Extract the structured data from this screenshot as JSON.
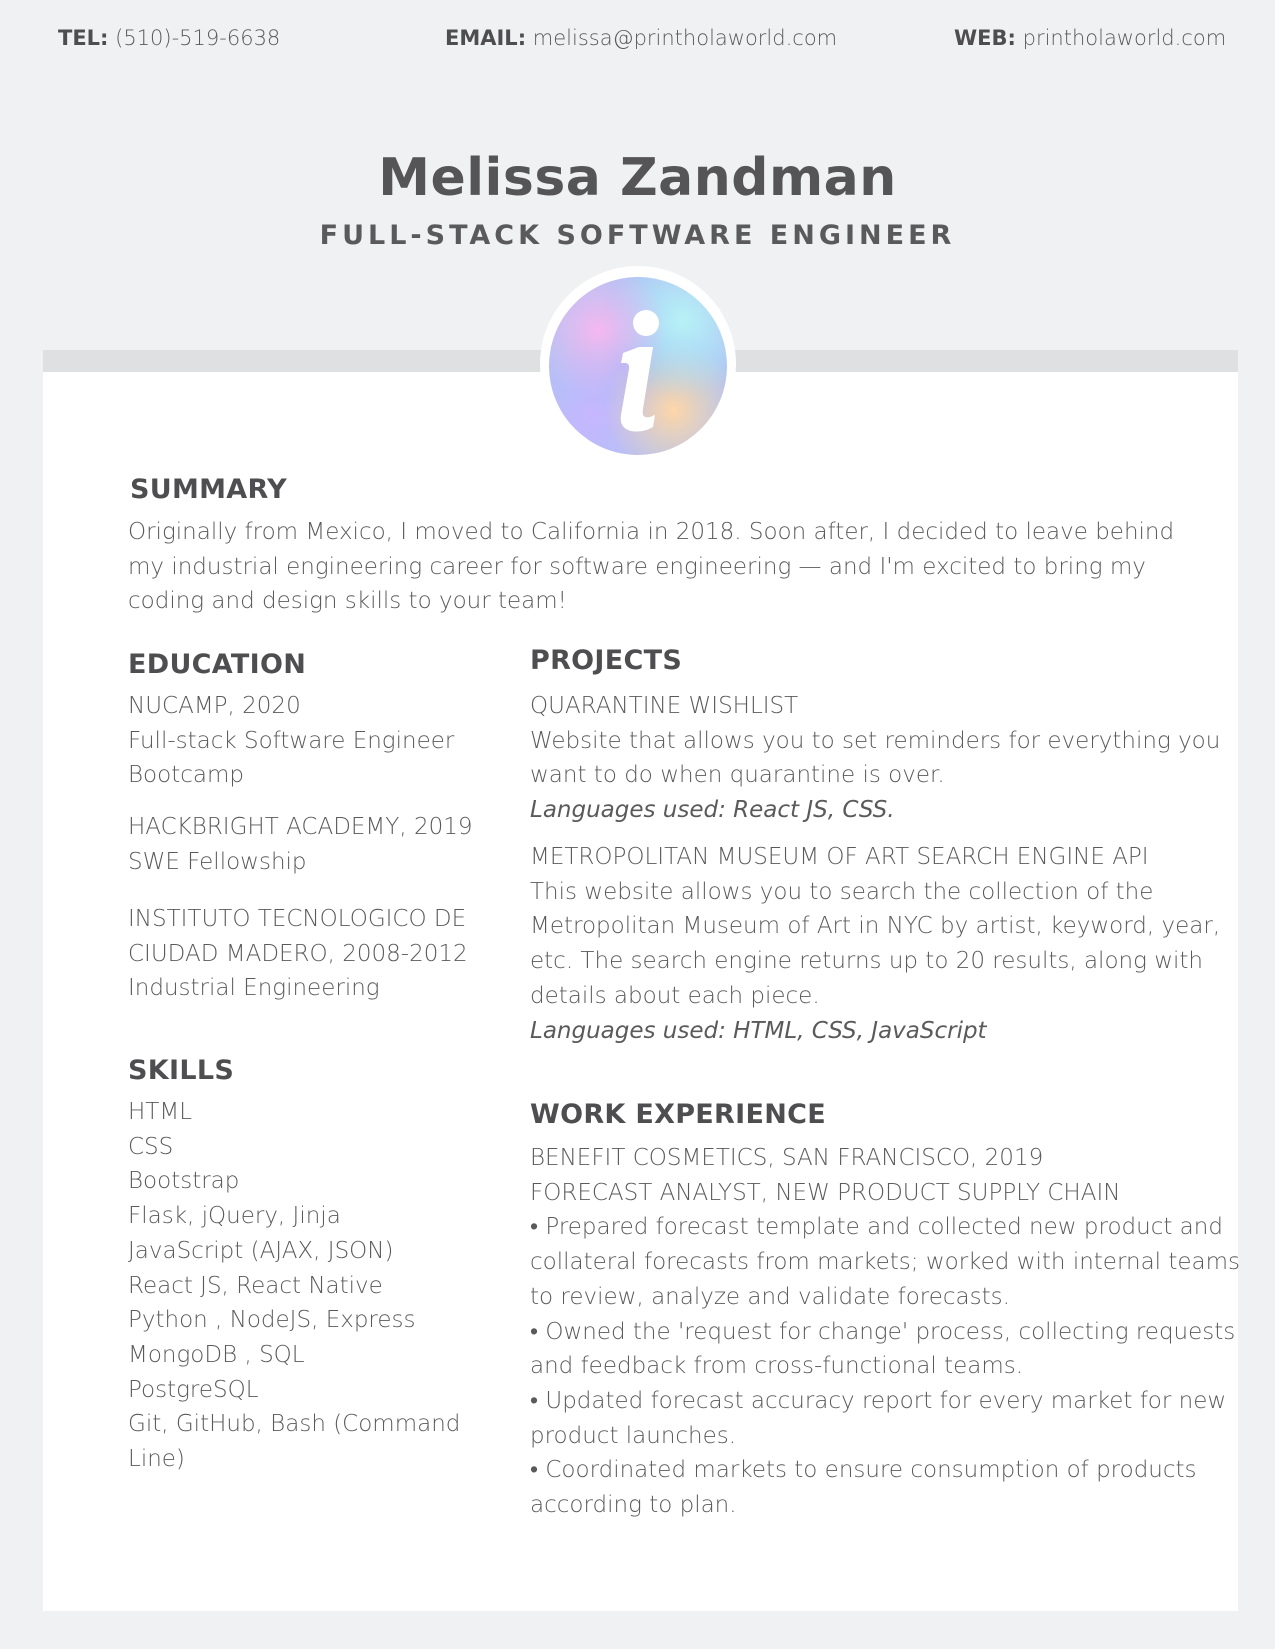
{
  "contact": {
    "tel_label": "TEL:",
    "tel": "(510)-519-6638",
    "email_label": "EMAIL:",
    "email": "melissa@printholaworld.com",
    "web_label": "WEB:",
    "web": "printholaworld.com"
  },
  "header": {
    "name": "Melissa Zandman",
    "title": "FULL-STACK SOFTWARE ENGINEER",
    "avatar_icon": "info-icon"
  },
  "summary": {
    "heading": "SUMMARY",
    "text": "Originally from Mexico, I moved to California in 2018. Soon after, I decided to leave behind my industrial engineering career for software engineering — and I'm excited to bring my coding and design skills to your team!"
  },
  "education": {
    "heading": "EDUCATION",
    "entries": [
      {
        "lines": [
          "NUCAMP, 2020",
          "Full-stack Software Engineer",
          "Bootcamp"
        ]
      },
      {
        "lines": [
          "HACKBRIGHT ACADEMY, 2019",
          "SWE Fellowship"
        ]
      },
      {
        "lines": [
          "INSTITUTO TECNOLOGICO DE",
          "CIUDAD MADERO, 2008-2012",
          "Industrial Engineering"
        ]
      }
    ]
  },
  "skills": {
    "heading": "SKILLS",
    "items": [
      "HTML",
      "CSS",
      "Bootstrap",
      "Flask, jQuery,  Jinja",
      "JavaScript (AJAX, JSON)",
      "React JS, React Native",
      "Python , NodeJS, Express",
      "MongoDB , SQL",
      "PostgreSQL",
      "Git, GitHub, Bash (Command",
      "Line)"
    ]
  },
  "projects": {
    "heading": "PROJECTS",
    "items": [
      {
        "name": "QUARANTINE WISHLIST",
        "lines": [
          "Website that allows you to set reminders for everything you",
          "want to do when quarantine is over."
        ],
        "languages": "Languages used: React JS, CSS."
      },
      {
        "name": "METROPOLITAN MUSEUM OF ART SEARCH ENGINE API",
        "lines": [
          "This website allows you to search the collection of the",
          "Metropolitan Museum of Art in NYC by artist, keyword, year,",
          "etc. The search engine returns up to 20 results, along with",
          "details about each piece."
        ],
        "languages": "Languages used: HTML, CSS, JavaScript"
      }
    ]
  },
  "work": {
    "heading": "WORK EXPERIENCE",
    "company": "BENEFIT COSMETICS, SAN FRANCISCO, 2019",
    "role": "FORECAST ANALYST, NEW PRODUCT SUPPLY CHAIN",
    "lines": [
      "• Prepared forecast template and collected new product and",
      "collateral forecasts from markets; worked with internal teams",
      "to review, analyze and validate forecasts.",
      "• Owned the 'request for change' process, collecting requests",
      "and feedback from cross-functional teams.",
      "• Updated forecast accuracy report for every market for new",
      "product launches.",
      "• Coordinated markets to ensure consumption of products",
      "according to plan."
    ]
  }
}
